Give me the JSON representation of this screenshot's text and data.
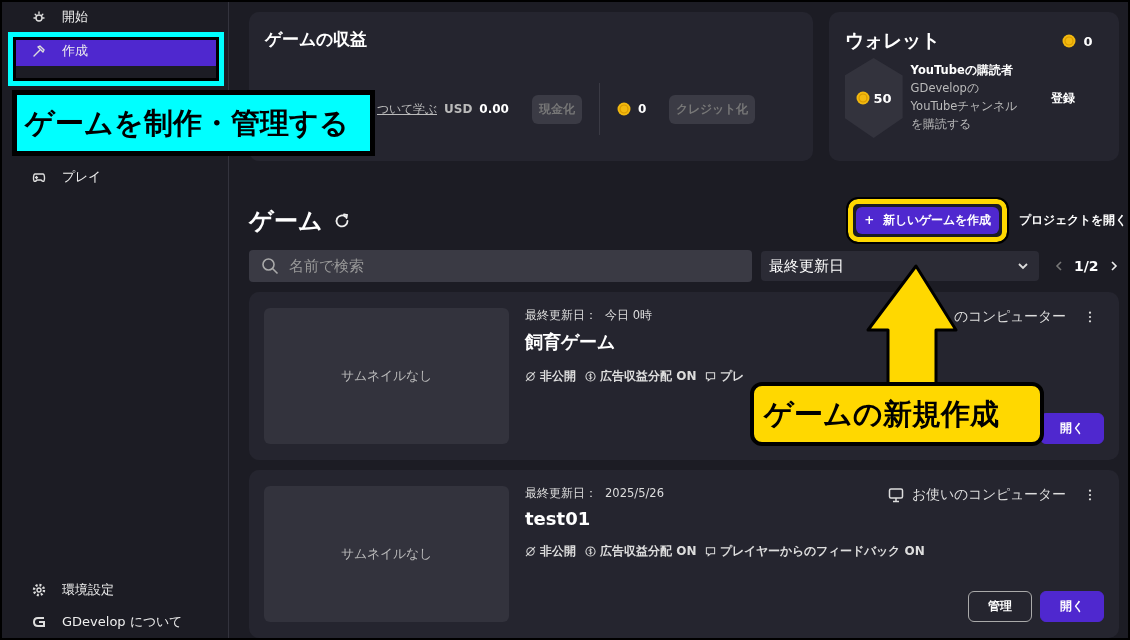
{
  "sidebar": {
    "items": [
      {
        "label": "開始",
        "selected": false
      },
      {
        "label": "作成",
        "selected": true
      },
      {
        "label": "プレイ",
        "selected": false
      }
    ],
    "footer_items": [
      {
        "label": "環境設定"
      },
      {
        "label": "GDevelop について"
      }
    ]
  },
  "revenue": {
    "title": "ゲームの収益",
    "learn_link": "ついて学ぶ",
    "currency": "USD",
    "amount": "0.00",
    "cash_out_button": {
      "label": "現金化",
      "disabled": true
    },
    "credits": "0",
    "credit_button": {
      "label": "クレジット化",
      "disabled": true
    }
  },
  "wallet": {
    "title": "ウォレット",
    "balance": "0",
    "reward": {
      "amount": "50",
      "title": "YouTubeの購読者",
      "description": "GDevelopのYouTubeチャンネルを購読する",
      "action": "登録"
    }
  },
  "games": {
    "title": "ゲーム",
    "new_game_button": {
      "icon": "+",
      "label": "新しいゲームを作成"
    },
    "open_project": "プロジェクトを開く",
    "search": {
      "placeholder": "名前で検索"
    },
    "sort": "最終更新日",
    "page": "1/2",
    "items": [
      {
        "updated_label": "最終更新日：",
        "updated": "今日 0時",
        "name": "飼育ゲーム",
        "thumbnail": "サムネイルなし",
        "location": "のコンピューター",
        "location_icon": false,
        "tags": [
          {
            "kind": "private",
            "label": "非公開"
          },
          {
            "kind": "ads",
            "label": "広告収益分配 ON"
          },
          {
            "kind": "feedback",
            "label": "プレ"
          }
        ],
        "buttons": [
          {
            "kind": "open",
            "label": "開く"
          }
        ]
      },
      {
        "updated_label": "最終更新日：",
        "updated": "2025/5/26",
        "name": "test01",
        "thumbnail": "サムネイルなし",
        "location": "お使いのコンピューター",
        "location_icon": true,
        "tags": [
          {
            "kind": "private",
            "label": "非公開"
          },
          {
            "kind": "ads",
            "label": "広告収益分配 ON"
          },
          {
            "kind": "feedback",
            "label": "プレイヤーからのフィードバック ON"
          }
        ],
        "buttons": [
          {
            "kind": "manage",
            "label": "管理"
          },
          {
            "kind": "open",
            "label": "開く"
          }
        ]
      }
    ]
  },
  "callouts": [
    {
      "kind": "cyan",
      "text": "ゲームを制作・管理する"
    },
    {
      "kind": "yellow",
      "text": "ゲームの新規作成"
    }
  ]
}
